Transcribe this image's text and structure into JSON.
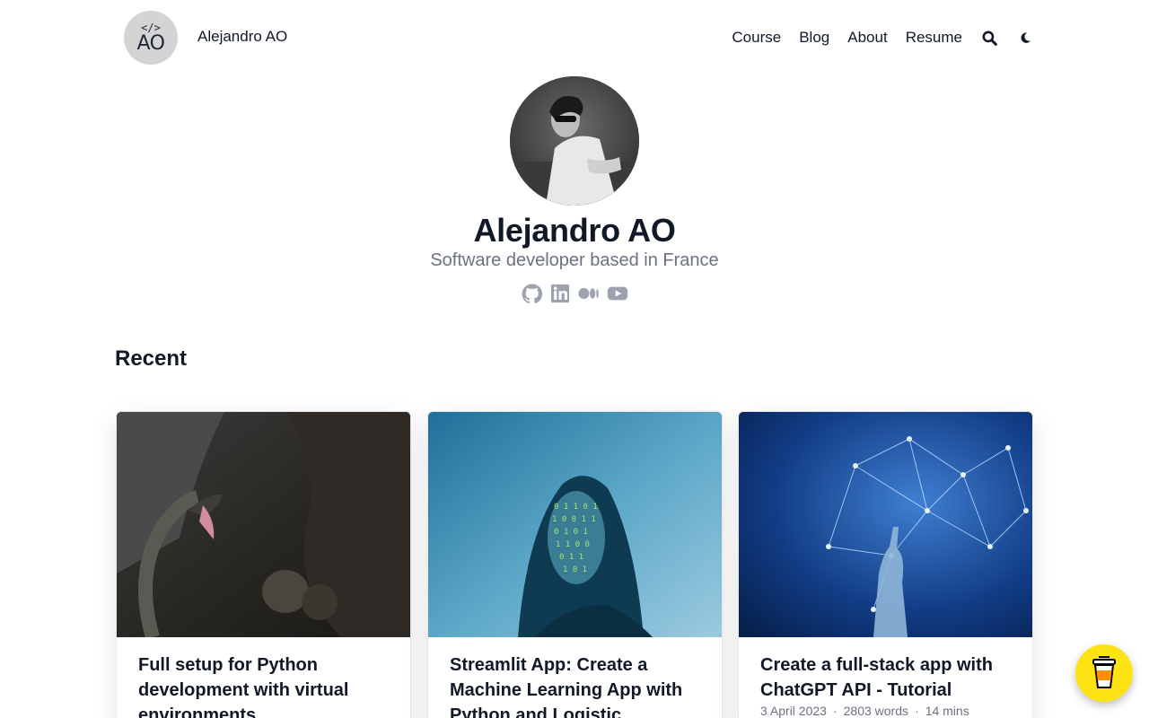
{
  "header": {
    "logo": {
      "code": "</>",
      "initials": "AO"
    },
    "site_name": "Alejandro AO",
    "nav": [
      {
        "label": "Course"
      },
      {
        "label": "Blog"
      },
      {
        "label": "About"
      },
      {
        "label": "Resume"
      }
    ],
    "icons": [
      "search-icon",
      "moon-icon"
    ]
  },
  "profile": {
    "name": "Alejandro AO",
    "headline": "Software developer based in France",
    "socials": [
      "github-icon",
      "linkedin-icon",
      "medium-icon",
      "youtube-icon"
    ]
  },
  "recent": {
    "title": "Recent",
    "cards": [
      {
        "title": "Full setup for Python development with virtual environments",
        "image": "snake-photo"
      },
      {
        "title": "Streamlit App: Create a Machine Learning App with Python and Logistic Regression",
        "image": "woman-binary-projection-photo"
      },
      {
        "title": "Create a full-stack app with ChatGPT API - Tutorial",
        "image": "robot-hand-network-photo",
        "date": "3 April 2023",
        "words": "2803 words",
        "reading_time": "14 mins"
      }
    ]
  },
  "buy_me_coffee": {
    "icon": "coffee-cup-icon",
    "color": "#fde314"
  },
  "colors": {
    "text": "#111827",
    "muted": "#6b7280",
    "icon": "#9ca3af"
  }
}
